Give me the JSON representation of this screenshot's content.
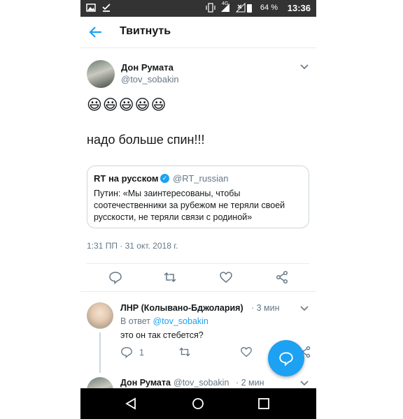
{
  "status_bar": {
    "network": "4G",
    "battery": "64 %",
    "time": "13:36"
  },
  "header": {
    "title": "Твитнуть"
  },
  "main_tweet": {
    "author_name": "Дон Румата",
    "author_handle": "@tov_sobakin",
    "emojis": "😃😃😃😃😃",
    "text": "надо больше спин!!!",
    "quote": {
      "name": "RT на русском",
      "handle": "@RT_russian",
      "text": "Путин: «Мы заинтересованы, чтобы соотечественники за рубежом не теряли своей русскости, не теряли связи с родиной»"
    },
    "timestamp": "1:31 ПП · 31 окт. 2018 г."
  },
  "replies": [
    {
      "name": "ЛНР (Колывано-Бджолария)",
      "time": "· 3 мин",
      "reply_to_prefix": "В ответ",
      "reply_to_mention": "@tov_sobakin",
      "text": "это он так стебется?",
      "reply_count": "1"
    },
    {
      "name": "Дон Румата",
      "handle": "@tov_sobakin",
      "time": "· 2 мин"
    }
  ],
  "colors": {
    "accent": "#1da1f2",
    "secondary_text": "#657786",
    "border": "#e6ecf0"
  },
  "icons": {
    "back": "arrow-left-icon",
    "reply": "reply-icon",
    "retweet": "retweet-icon",
    "like": "heart-icon",
    "share": "share-icon",
    "fab": "compose-reply-icon"
  }
}
